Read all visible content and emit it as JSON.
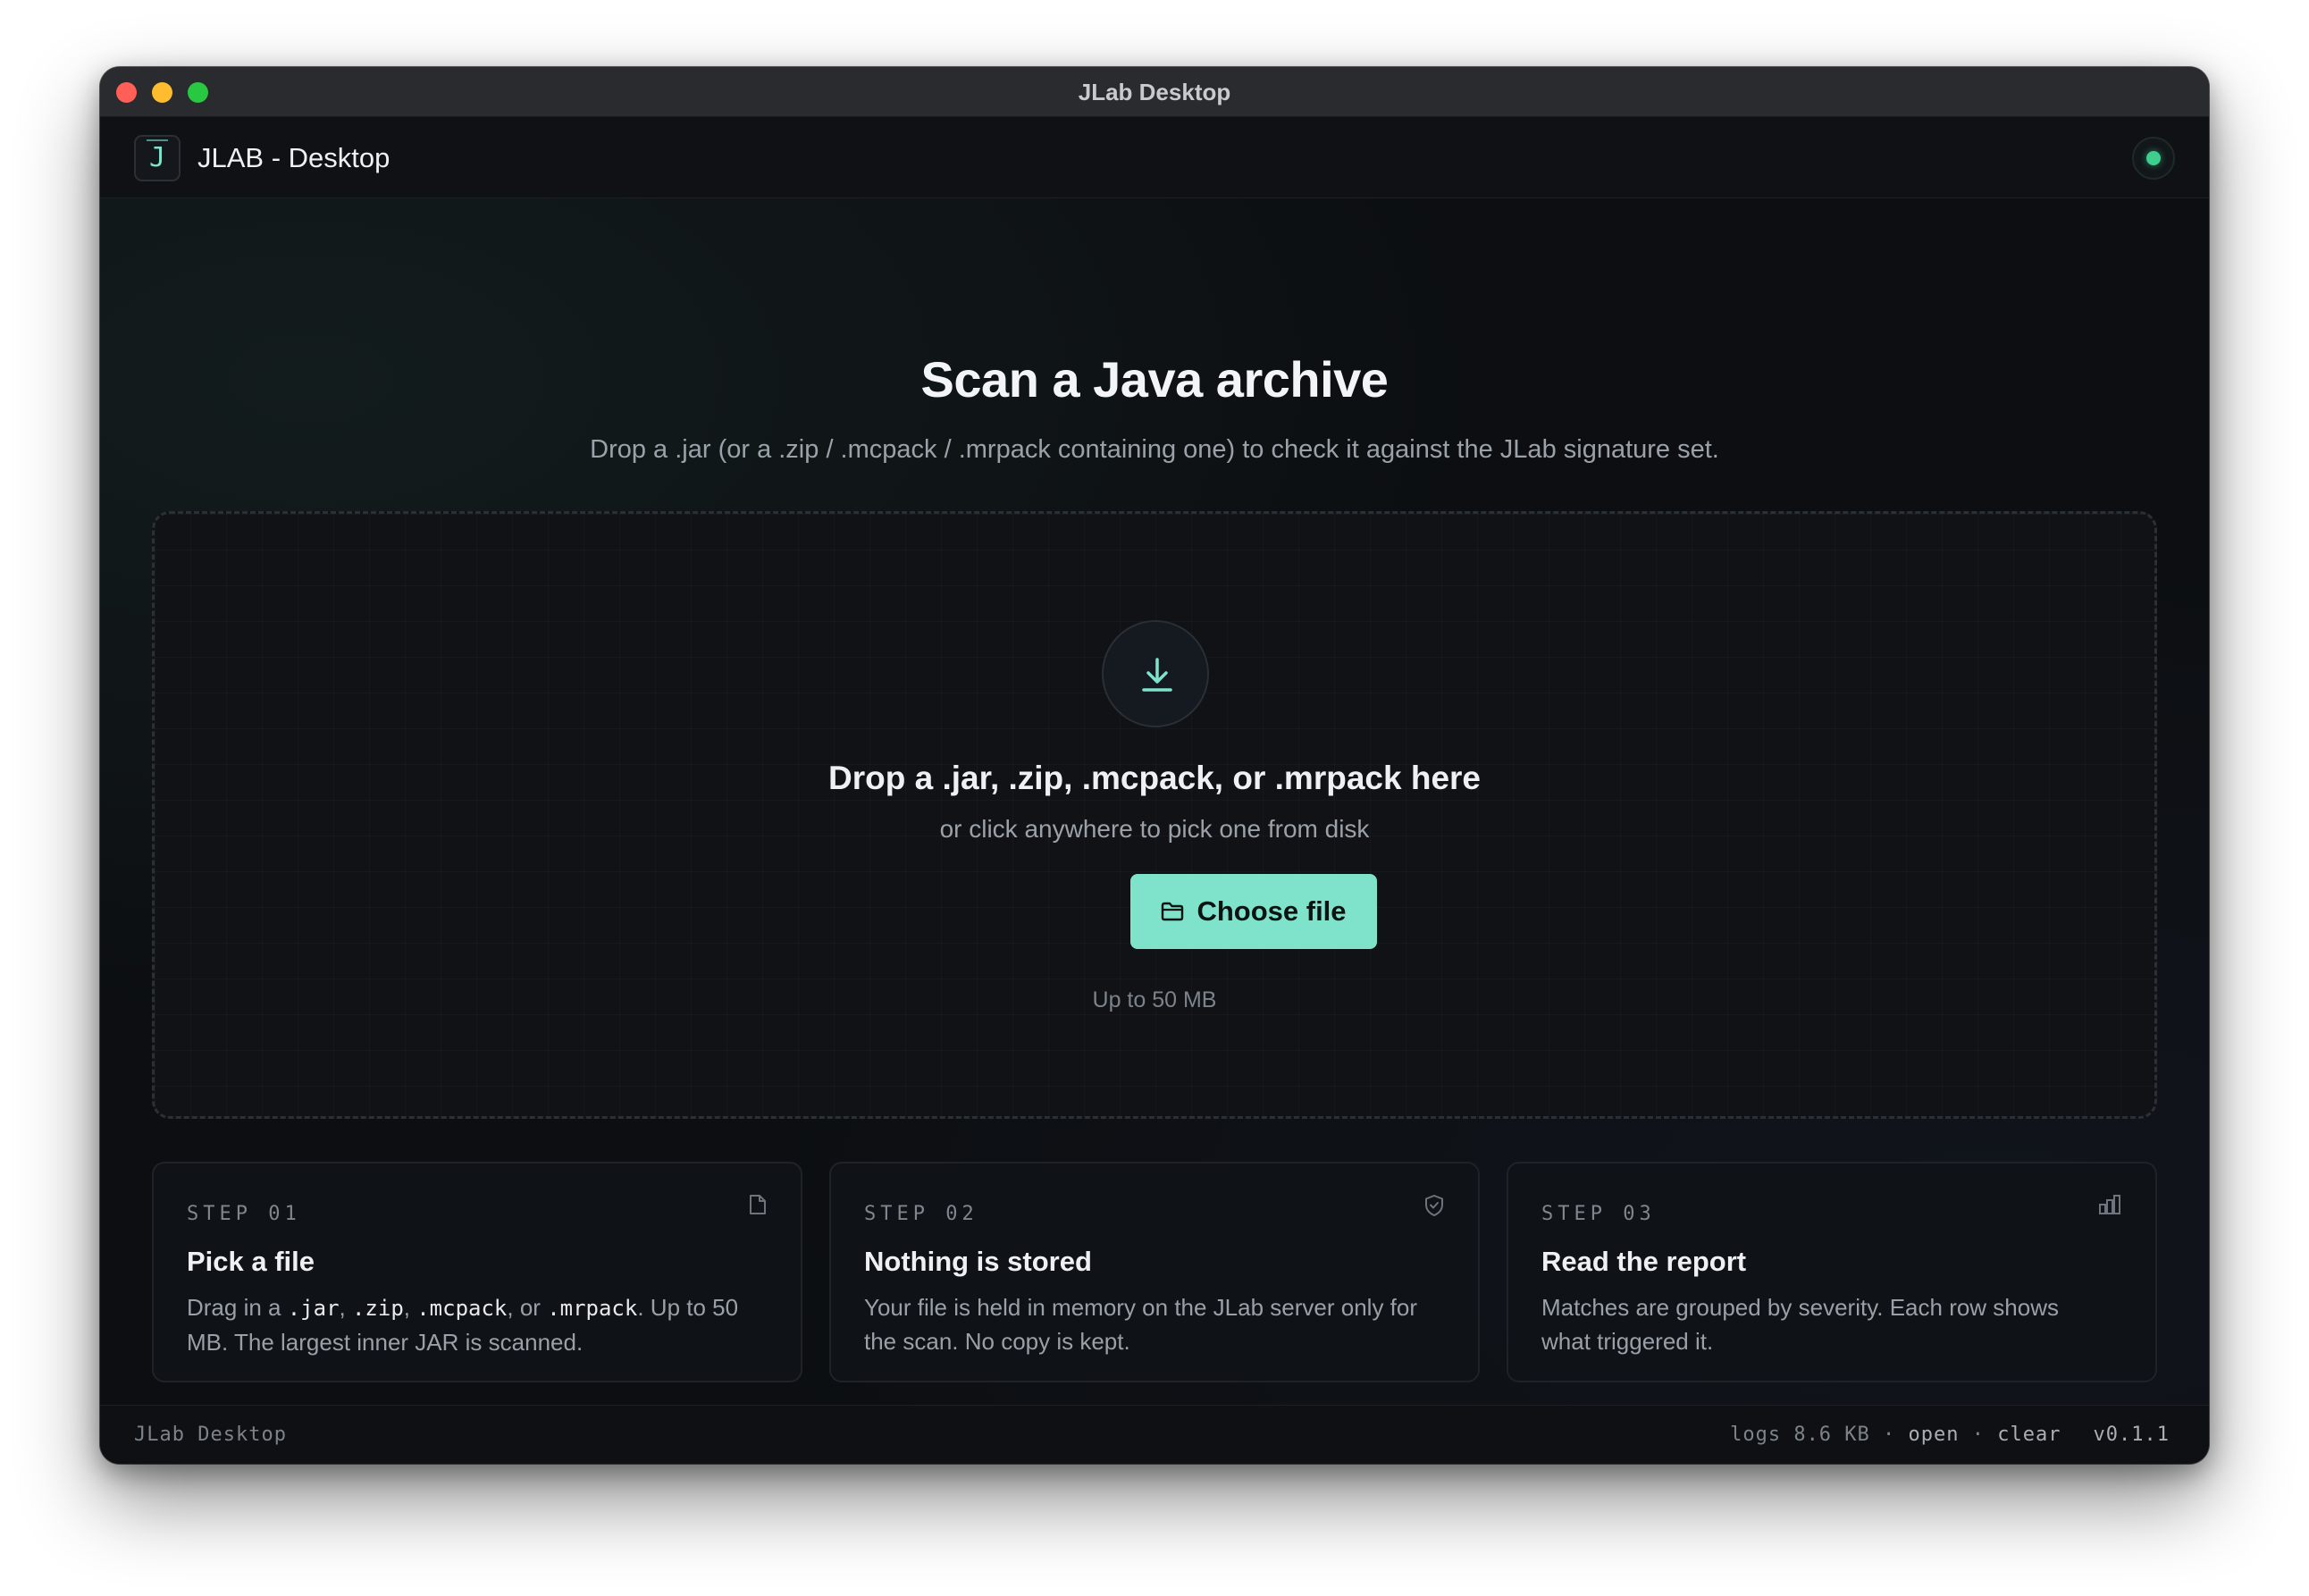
{
  "window": {
    "title": "JLab Desktop"
  },
  "appbar": {
    "name": "JLAB - Desktop",
    "logo_letter": "J",
    "status": "connected"
  },
  "main": {
    "heading": "Scan a Java archive",
    "subheading": "Drop a .jar (or a .zip / .mcpack / .mrpack containing one) to check it against the JLab signature set.",
    "dropzone": {
      "title": "Drop a .jar, .zip, .mcpack, or .mrpack here",
      "subtitle": "or click anywhere to pick one from disk",
      "button_label": "Choose file",
      "limit": "Up to 50 MB"
    },
    "steps": [
      {
        "label": "STEP 01",
        "title": "Pick a file",
        "icon": "file-icon",
        "desc_parts": [
          "Drag in a ",
          ".jar",
          ", ",
          ".zip",
          ", ",
          ".mcpack",
          ", or ",
          ".mrpack",
          ". Up to 50 MB. The largest inner JAR is scanned."
        ]
      },
      {
        "label": "STEP 02",
        "title": "Nothing is stored",
        "icon": "shield-icon",
        "desc": "Your file is held in memory on the JLab server only for the scan. No copy is kept."
      },
      {
        "label": "STEP 03",
        "title": "Read the report",
        "icon": "bar-chart-icon",
        "desc": "Matches are grouped by severity. Each row shows what triggered it."
      }
    ]
  },
  "footer": {
    "left": "JLab Desktop",
    "logs_label": "logs 8.6 KB",
    "sep": " · ",
    "open_label": "open",
    "clear_label": "clear",
    "version": "v0.1.1"
  },
  "colors": {
    "accent": "#7fe3cc",
    "status_green": "#3ecf8e",
    "background": "#0c0e11"
  }
}
